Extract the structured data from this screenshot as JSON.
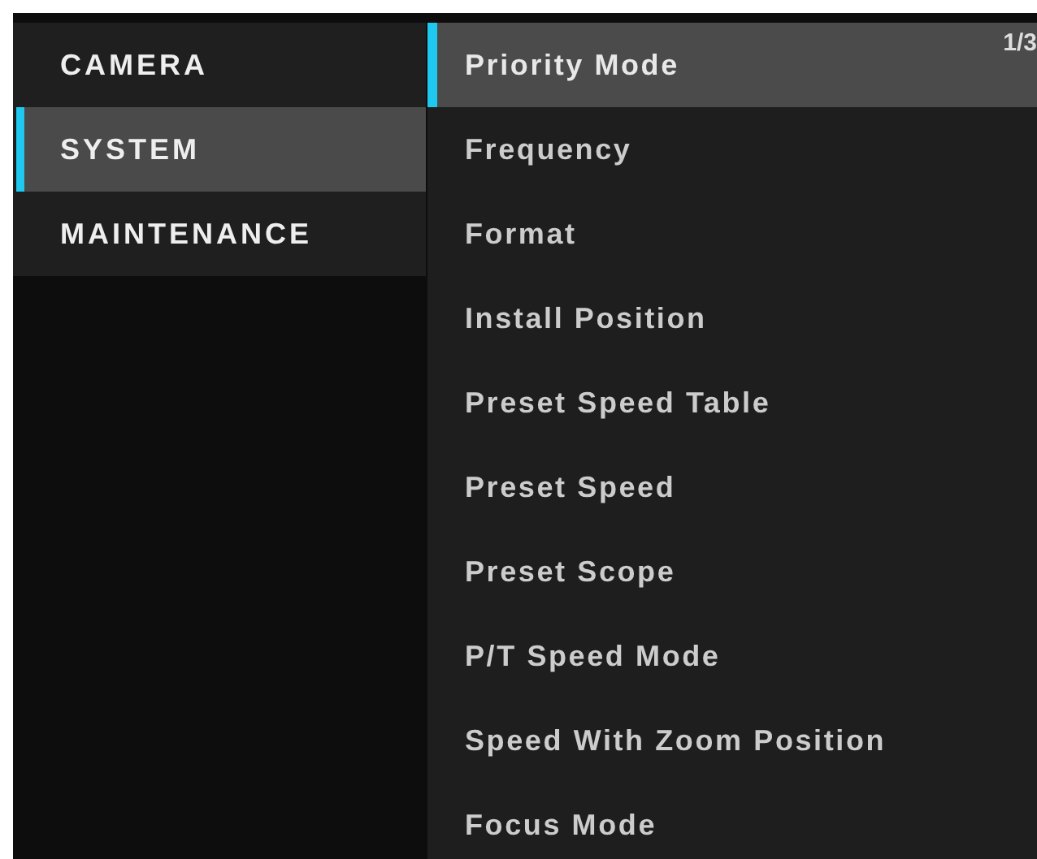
{
  "categories": [
    {
      "label": "CAMERA",
      "selected": false
    },
    {
      "label": "SYSTEM",
      "selected": true
    },
    {
      "label": "MAINTENANCE",
      "selected": false
    }
  ],
  "page_indicator": "1/3",
  "items": [
    {
      "label": "Priority Mode",
      "selected": true
    },
    {
      "label": "Frequency",
      "selected": false
    },
    {
      "label": "Format",
      "selected": false
    },
    {
      "label": "Install Position",
      "selected": false
    },
    {
      "label": "Preset Speed Table",
      "selected": false
    },
    {
      "label": "Preset Speed",
      "selected": false
    },
    {
      "label": "Preset Scope",
      "selected": false
    },
    {
      "label": "P/T Speed Mode",
      "selected": false
    },
    {
      "label": "Speed With Zoom Position",
      "selected": false
    },
    {
      "label": "Focus Mode",
      "selected": false
    }
  ]
}
